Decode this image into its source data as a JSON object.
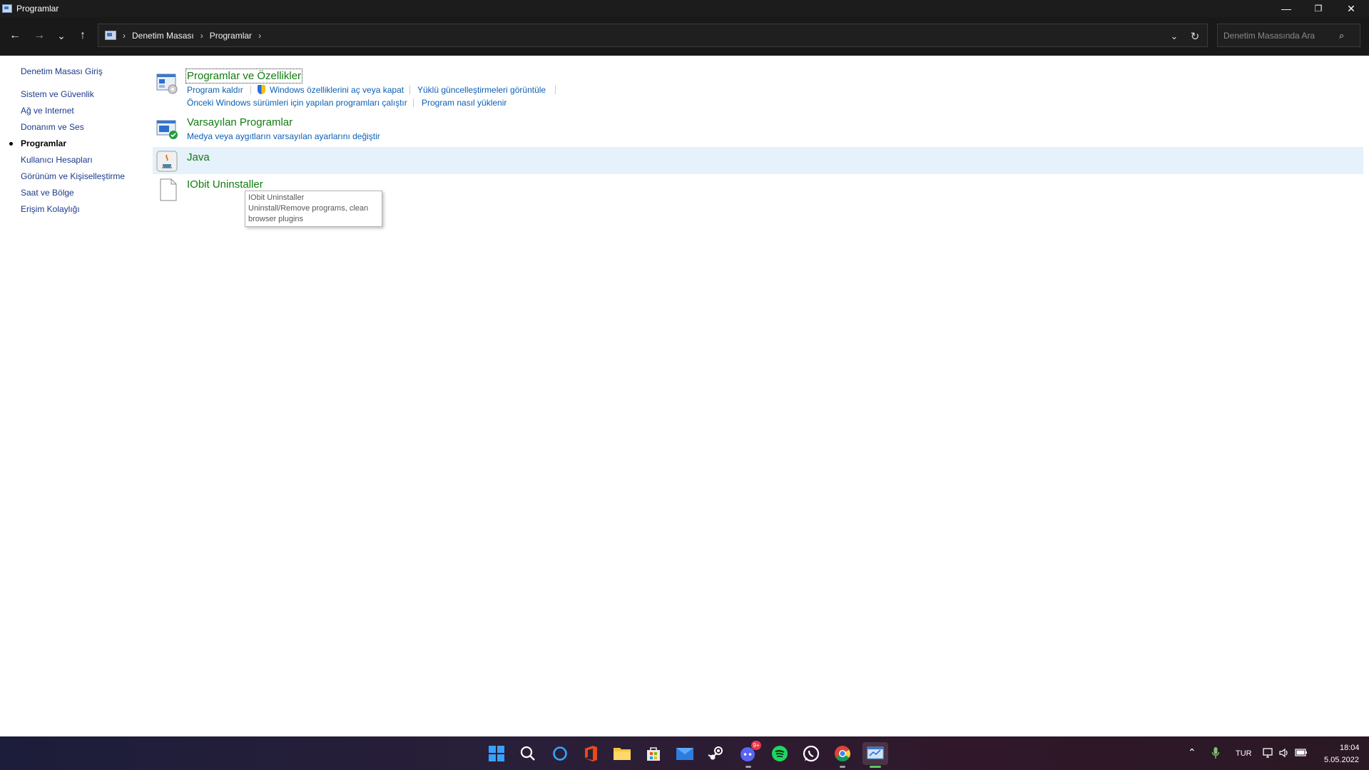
{
  "window": {
    "title": "Programlar",
    "minimize_glyph": "—",
    "restore_glyph": "❐",
    "close_glyph": "✕"
  },
  "nav": {
    "back_glyph": "←",
    "forward_glyph": "→",
    "recent_glyph": "⌄",
    "up_glyph": "↑",
    "crumb_sep": "›",
    "breadcrumbs": [
      "Denetim Masası",
      "Programlar"
    ],
    "dropdown_glyph": "⌄",
    "refresh_glyph": "↻",
    "search_placeholder": "Denetim Masasında Ara",
    "search_glyph": "⌕"
  },
  "sidebar": {
    "home": "Denetim Masası Giriş",
    "items": [
      {
        "label": "Sistem ve Güvenlik"
      },
      {
        "label": "Ağ ve Internet"
      },
      {
        "label": "Donanım ve Ses"
      },
      {
        "label": "Programlar",
        "active": true
      },
      {
        "label": "Kullanıcı Hesapları"
      },
      {
        "label": "Görünüm ve Kişiselleştirme"
      },
      {
        "label": "Saat ve Bölge"
      },
      {
        "label": "Erişim Kolaylığı"
      }
    ]
  },
  "categories": {
    "programs_features": {
      "title": "Programlar ve Özellikler",
      "links": [
        "Program kaldır",
        "Windows özelliklerini aç veya kapat",
        "Yüklü güncelleştirmeleri görüntüle",
        "Önceki Windows sürümleri için yapılan programları çalıştır",
        "Program nasıl yüklenir"
      ]
    },
    "default_programs": {
      "title": "Varsayılan Programlar",
      "links": [
        "Medya veya aygıtların varsayılan ayarlarını değiştir"
      ]
    },
    "java": {
      "title": "Java"
    },
    "iobit": {
      "title": "IObit Uninstaller"
    }
  },
  "tooltip": {
    "line1": "IObit Uninstaller",
    "line2": "Uninstall/Remove programs, clean",
    "line3": "browser plugins"
  },
  "taskbar": {
    "icons": [
      "windows-start",
      "search",
      "cortana",
      "office",
      "file-explorer",
      "microsoft-store",
      "mail",
      "steam",
      "discord",
      "spotify",
      "whatsapp",
      "chrome",
      "control-panel"
    ],
    "discord_badge": "9+",
    "language": "TUR",
    "time": "18:04",
    "date": "5.05.2022",
    "chevron_glyph": "⌃"
  },
  "colors": {
    "link_green": "#107c10",
    "link_blue": "#0b5fb4",
    "sidebar_link": "#1a3a8a",
    "hover_row": "#e5f1fb",
    "titlebar": "#1c1c1c"
  }
}
